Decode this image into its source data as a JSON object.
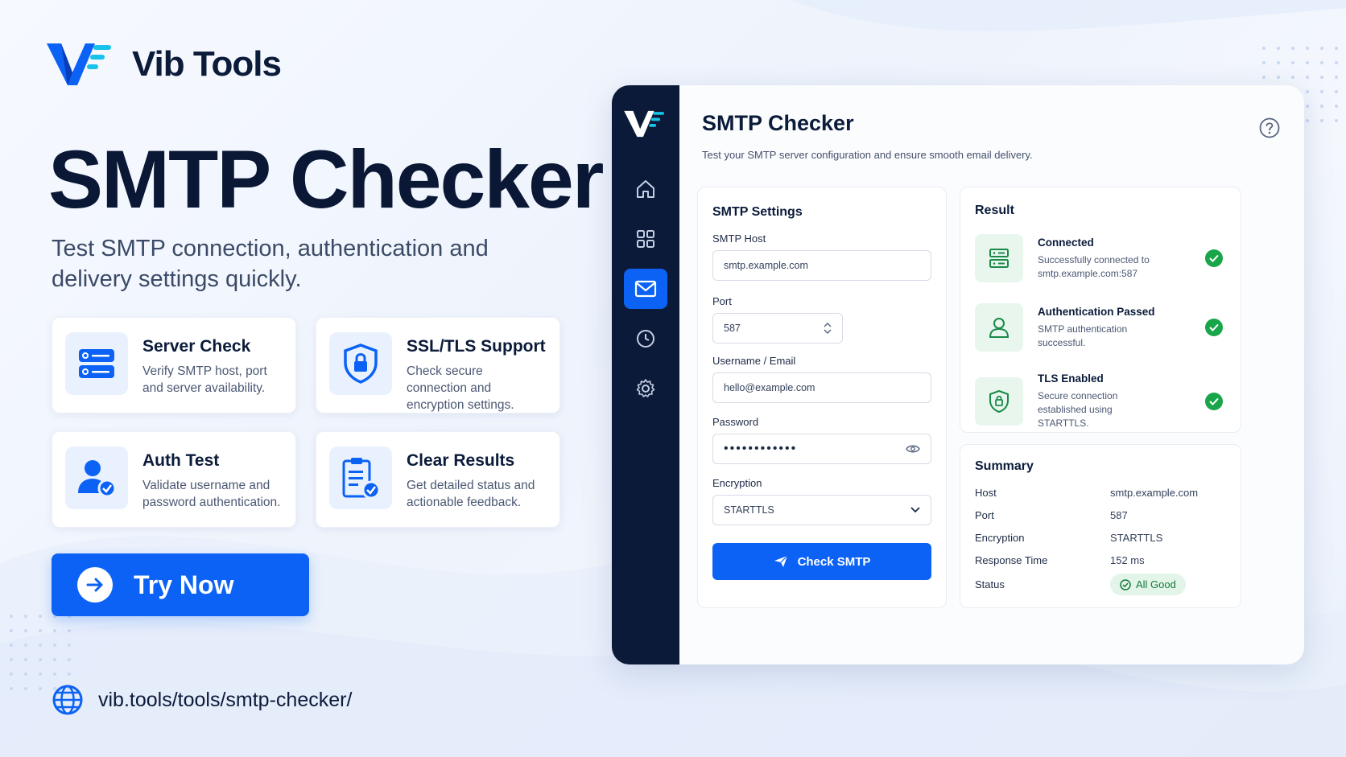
{
  "brand": {
    "name": "Vib Tools"
  },
  "hero": {
    "title": "SMTP Checker",
    "subtitle": "Test SMTP connection, authentication and delivery settings quickly."
  },
  "features": [
    {
      "title": "Server Check",
      "desc": "Verify SMTP host, port and server availability.",
      "icon": "server-icon"
    },
    {
      "title": "SSL/TLS Support",
      "desc": "Check secure connection and encryption settings.",
      "icon": "shield-lock-icon"
    },
    {
      "title": "Auth Test",
      "desc": "Validate username and password authentication.",
      "icon": "user-check-icon"
    },
    {
      "title": "Clear Results",
      "desc": "Get detailed status and actionable feedback.",
      "icon": "clipboard-check-icon"
    }
  ],
  "cta": {
    "label": "Try Now"
  },
  "url": "vib.tools/tools/smtp-checker/",
  "app": {
    "title": "SMTP Checker",
    "description": "Test your SMTP server configuration and ensure smooth email delivery.",
    "nav": [
      "home-icon",
      "grid-icon",
      "mail-icon",
      "clock-icon",
      "gear-icon"
    ],
    "settings": {
      "heading": "SMTP Settings",
      "host_label": "SMTP Host",
      "host_value": "smtp.example.com",
      "port_label": "Port",
      "port_value": "587",
      "user_label": "Username / Email",
      "user_value": "hello@example.com",
      "password_label": "Password",
      "password_value": "••••••••••••",
      "encryption_label": "Encryption",
      "encryption_value": "STARTTLS",
      "check_label": "Check SMTP"
    },
    "result": {
      "heading": "Result",
      "items": [
        {
          "title": "Connected",
          "desc": "Successfully connected to smtp.example.com:587"
        },
        {
          "title": "Authentication Passed",
          "desc": "SMTP authentication successful."
        },
        {
          "title": "TLS Enabled",
          "desc": "Secure connection established using STARTTLS."
        }
      ]
    },
    "summary": {
      "heading": "Summary",
      "rows": [
        {
          "k": "Host",
          "v": "smtp.example.com"
        },
        {
          "k": "Port",
          "v": "587"
        },
        {
          "k": "Encryption",
          "v": "STARTTLS"
        },
        {
          "k": "Response Time",
          "v": "152 ms"
        }
      ],
      "status_label": "Status",
      "status_value": "All Good"
    }
  },
  "colors": {
    "accent": "#0b62f5",
    "sidebar": "#0c1a3a",
    "success": "#19a64b"
  }
}
